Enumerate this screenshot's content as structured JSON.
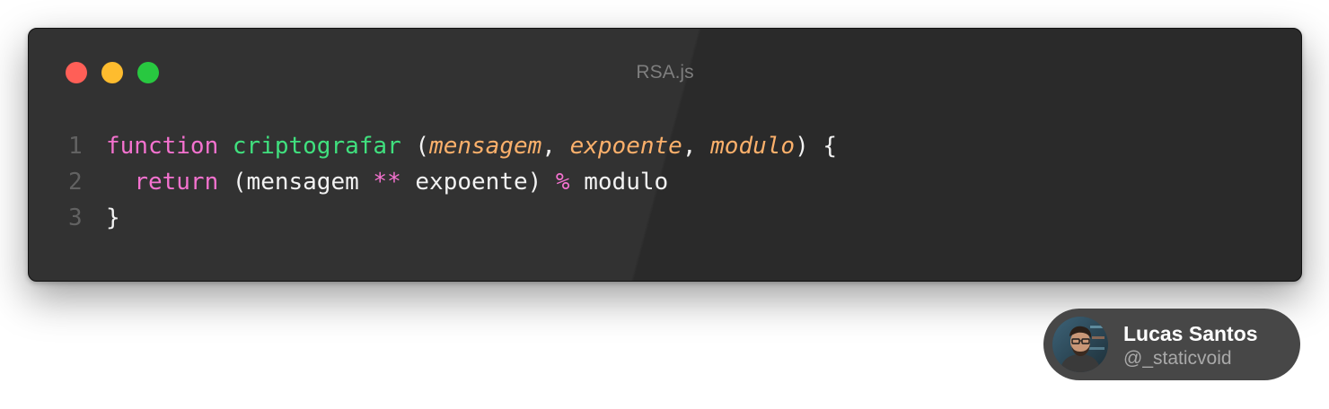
{
  "window": {
    "title": "RSA.js",
    "traffic_lights": {
      "close": "#ff5f57",
      "minimize": "#febc2e",
      "zoom": "#28c840"
    }
  },
  "code": {
    "lines": [
      {
        "number": "1",
        "tokens": [
          {
            "text": "function",
            "kind": "keyword"
          },
          {
            "text": " ",
            "kind": "plain"
          },
          {
            "text": "criptografar",
            "kind": "function"
          },
          {
            "text": " (",
            "kind": "plain"
          },
          {
            "text": "mensagem",
            "kind": "param"
          },
          {
            "text": ", ",
            "kind": "plain"
          },
          {
            "text": "expoente",
            "kind": "param"
          },
          {
            "text": ", ",
            "kind": "plain"
          },
          {
            "text": "modulo",
            "kind": "param"
          },
          {
            "text": ") {",
            "kind": "plain"
          }
        ]
      },
      {
        "number": "2",
        "tokens": [
          {
            "text": "  ",
            "kind": "plain"
          },
          {
            "text": "return",
            "kind": "keyword"
          },
          {
            "text": " (mensagem ",
            "kind": "plain"
          },
          {
            "text": "**",
            "kind": "operator"
          },
          {
            "text": " expoente) ",
            "kind": "plain"
          },
          {
            "text": "%",
            "kind": "operator"
          },
          {
            "text": " modulo",
            "kind": "plain"
          }
        ]
      },
      {
        "number": "3",
        "tokens": [
          {
            "text": "}",
            "kind": "plain"
          }
        ]
      }
    ],
    "colors": {
      "keyword": "#f472cf",
      "function": "#40e07e",
      "param": "#fbb06b",
      "operator": "#f472cf",
      "plain": "#f2f2f2"
    }
  },
  "author": {
    "name": "Lucas Santos",
    "handle": "@_staticvoid"
  }
}
